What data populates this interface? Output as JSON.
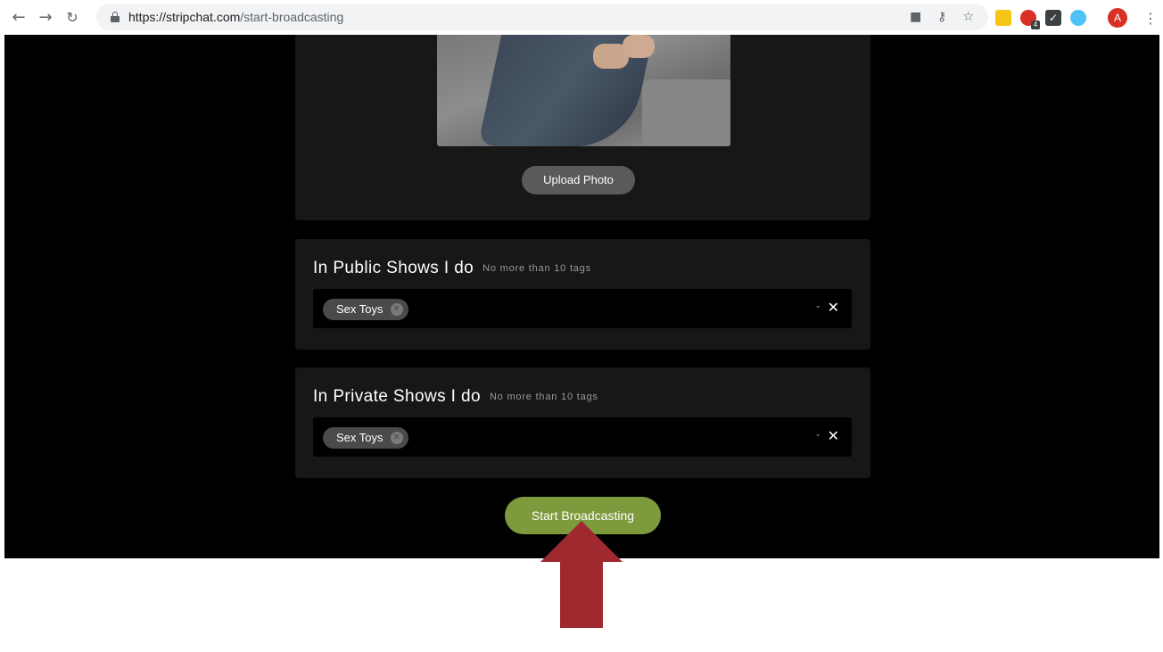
{
  "browser": {
    "url_host": "https://stripchat.com",
    "url_path": "/start-broadcasting",
    "avatar_letter": "A",
    "extension_badge": "4"
  },
  "photo_section": {
    "upload_label": "Upload Photo"
  },
  "public_tags": {
    "title": "In Public Shows I do",
    "hint": "No more than 10 tags",
    "chips": [
      "Sex Toys"
    ]
  },
  "private_tags": {
    "title": "In Private Shows I do",
    "hint": "No more than 10 tags",
    "chips": [
      "Sex Toys"
    ]
  },
  "actions": {
    "start_label": "Start Broadcasting"
  },
  "colors": {
    "start_button": "#7d9a3c",
    "annotation_arrow": "#a0282f",
    "card_background": "#171717"
  }
}
